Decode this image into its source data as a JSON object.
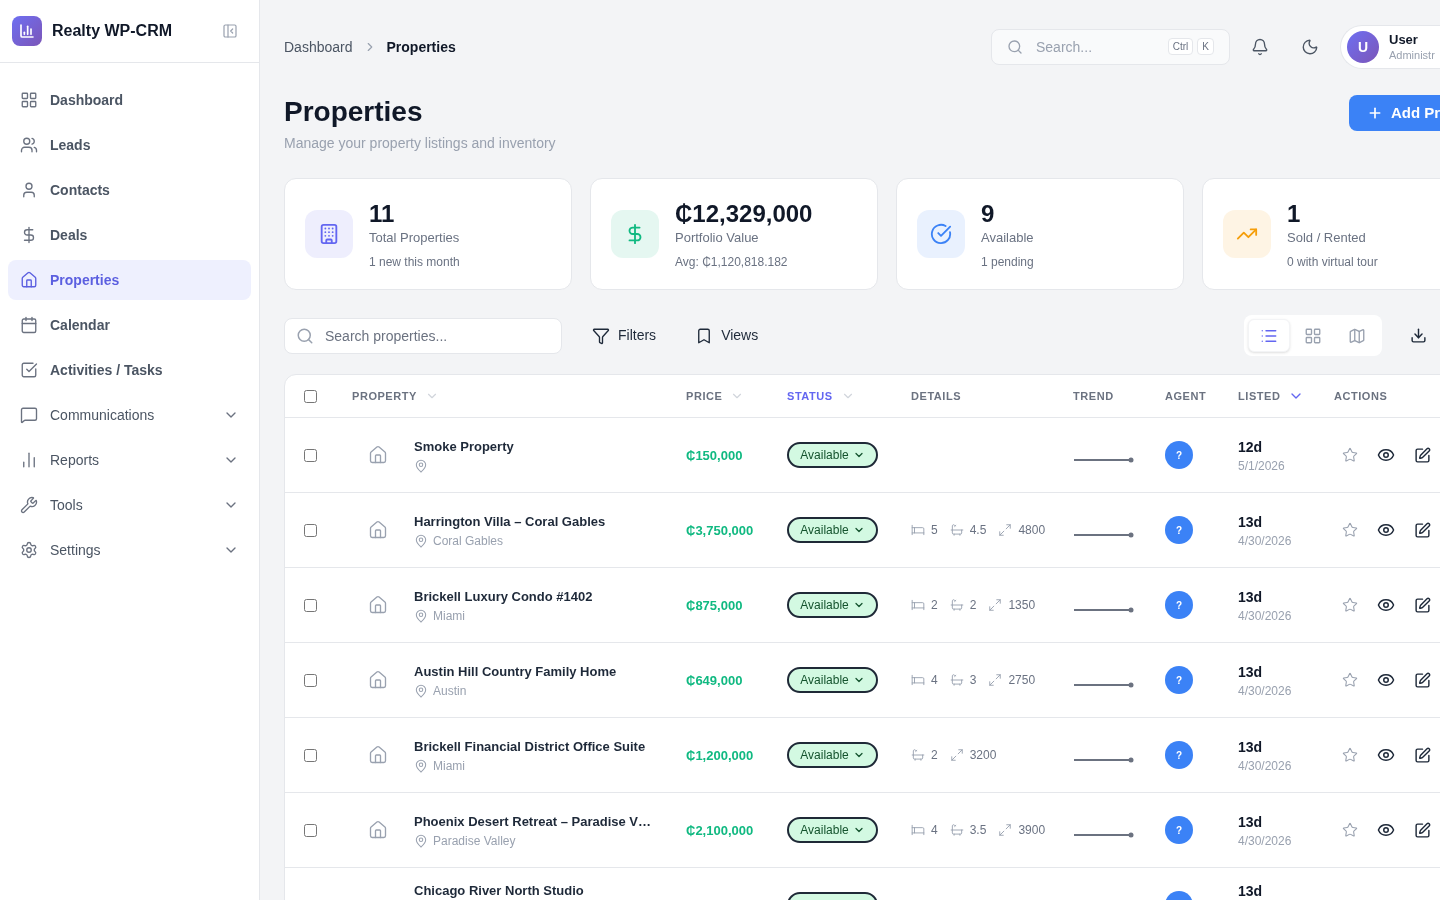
{
  "sidebar": {
    "brand": "Realty WP-CRM",
    "items": [
      {
        "label": "Dashboard",
        "selected": false
      },
      {
        "label": "Leads",
        "selected": false
      },
      {
        "label": "Contacts",
        "selected": false
      },
      {
        "label": "Deals",
        "selected": false
      },
      {
        "label": "Properties",
        "selected": true
      },
      {
        "label": "Calendar",
        "selected": false
      },
      {
        "label": "Activities / Tasks",
        "selected": false
      },
      {
        "label": "Communications",
        "selected": false,
        "expanded": false
      },
      {
        "label": "Reports",
        "selected": false,
        "expanded": false
      },
      {
        "label": "Tools",
        "selected": false,
        "expanded": false
      },
      {
        "label": "Settings",
        "selected": false,
        "expanded": false
      }
    ]
  },
  "header": {
    "breadcrumb": [
      "Dashboard",
      "Properties"
    ],
    "search": {
      "placeholder": "Search...",
      "shortcut": [
        "Ctrl",
        "K"
      ]
    },
    "user": {
      "initial": "U",
      "name": "User",
      "role": "Administr"
    }
  },
  "page": {
    "title": "Properties",
    "subtitle": "Manage your property listings and inventory",
    "add_button": "Add Pr"
  },
  "stats": [
    {
      "color": "#6366f1",
      "value": "11",
      "label": "Total Properties",
      "note": "1 new this month"
    },
    {
      "color": "#10b981",
      "value": "₵12,329,000",
      "label": "Portfolio Value",
      "note": "Avg: ₵1,120,818.182"
    },
    {
      "color": "#3b82f6",
      "value": "9",
      "label": "Available",
      "note": "1 pending"
    },
    {
      "color": "#f59e0b",
      "value": "1",
      "label": "Sold / Rented",
      "note": "0 with virtual tour"
    }
  ],
  "toolbar": {
    "search_placeholder": "Search properties...",
    "buttons": [
      "Filters",
      "Views"
    ],
    "view_modes": [
      {
        "kind": "list",
        "selected": true
      },
      {
        "kind": "grid",
        "selected": false
      },
      {
        "kind": "map",
        "selected": false
      }
    ]
  },
  "table": {
    "select_all": {
      "checked": false
    },
    "columns": [
      {
        "label": "PROPERTY",
        "sortable": true,
        "highlighted": false,
        "sorted": false
      },
      {
        "label": "PRICE",
        "sortable": true,
        "highlighted": false,
        "sorted": false
      },
      {
        "label": "STATUS",
        "sortable": true,
        "highlighted": true,
        "sorted": false
      },
      {
        "label": "DETAILS",
        "sortable": false,
        "highlighted": false,
        "sorted": false
      },
      {
        "label": "TREND",
        "sortable": false,
        "highlighted": false,
        "sorted": false
      },
      {
        "label": "AGENT",
        "sortable": false,
        "highlighted": false,
        "sorted": false
      },
      {
        "label": "LISTED",
        "sortable": true,
        "highlighted": false,
        "sorted": true
      },
      {
        "label": "ACTIONS",
        "sortable": false,
        "highlighted": false,
        "sorted": false
      }
    ],
    "rows": [
      {
        "kind": "full",
        "checked": false,
        "name": "Smoke Property",
        "price": "₵150,000",
        "status": {
          "kind": "available",
          "label": "Available"
        },
        "agent": "?",
        "age": "12d",
        "date": "5/1/2026",
        "starred": false
      },
      {
        "kind": "full",
        "checked": false,
        "name": "Harrington Villa – Coral Gables",
        "location": "Coral Gables",
        "price": "₵3,750,000",
        "status": {
          "kind": "available",
          "label": "Available"
        },
        "details": [
          {
            "kind": "beds",
            "value": "5"
          },
          {
            "kind": "baths",
            "value": "4.5"
          },
          {
            "kind": "area",
            "value": "4800"
          }
        ],
        "agent": "?",
        "age": "13d",
        "date": "4/30/2026",
        "starred": false
      },
      {
        "kind": "full",
        "checked": false,
        "name": "Brickell Luxury Condo #1402",
        "location": "Miami",
        "price": "₵875,000",
        "status": {
          "kind": "available",
          "label": "Available"
        },
        "details": [
          {
            "kind": "beds",
            "value": "2"
          },
          {
            "kind": "baths",
            "value": "2"
          },
          {
            "kind": "area",
            "value": "1350"
          }
        ],
        "agent": "?",
        "age": "13d",
        "date": "4/30/2026",
        "starred": false
      },
      {
        "kind": "full",
        "checked": false,
        "name": "Austin Hill Country Family Home",
        "location": "Austin",
        "price": "₵649,000",
        "status": {
          "kind": "available",
          "label": "Available"
        },
        "details": [
          {
            "kind": "beds",
            "value": "4"
          },
          {
            "kind": "baths",
            "value": "3"
          },
          {
            "kind": "area",
            "value": "2750"
          }
        ],
        "agent": "?",
        "age": "13d",
        "date": "4/30/2026",
        "starred": false
      },
      {
        "kind": "full",
        "checked": false,
        "name": "Brickell Financial District Office Suite",
        "location": "Miami",
        "price": "₵1,200,000",
        "status": {
          "kind": "available",
          "label": "Available"
        },
        "details": [
          {
            "kind": "baths",
            "value": "2"
          },
          {
            "kind": "area",
            "value": "3200"
          }
        ],
        "agent": "?",
        "age": "13d",
        "date": "4/30/2026",
        "starred": false
      },
      {
        "kind": "full",
        "checked": false,
        "name": "Phoenix Desert Retreat – Paradise V…",
        "location": "Paradise Valley",
        "price": "₵2,100,000",
        "status": {
          "kind": "available",
          "label": "Available"
        },
        "details": [
          {
            "kind": "beds",
            "value": "4"
          },
          {
            "kind": "baths",
            "value": "3.5"
          },
          {
            "kind": "area",
            "value": "3900"
          }
        ],
        "agent": "?",
        "age": "13d",
        "date": "4/30/2026",
        "starred": false
      },
      {
        "kind": "partial",
        "name": "Chicago River North Studio",
        "status": {
          "kind": "available"
        },
        "age": "13d"
      }
    ]
  }
}
